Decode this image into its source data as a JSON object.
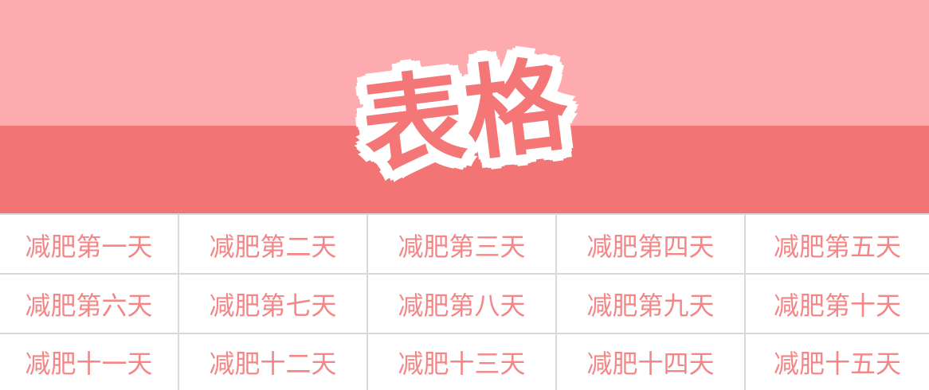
{
  "title": "表格",
  "colors": {
    "band_top": "#feabaf",
    "band_bottom": "#f27474",
    "title_fill": "#f57676",
    "title_outline": "#ffffff",
    "cell_text": "#f38787",
    "grid_line": "#d9d9d9"
  },
  "table": {
    "rows": [
      [
        "减肥第一天",
        "减肥第二天",
        "减肥第三天",
        "减肥第四天",
        "减肥第五天"
      ],
      [
        "减肥第六天",
        "减肥第七天",
        "减肥第八天",
        "减肥第九天",
        "减肥第十天"
      ],
      [
        "减肥十一天",
        "减肥十二天",
        "减肥十三天",
        "减肥十四天",
        "减肥十五天"
      ]
    ]
  }
}
